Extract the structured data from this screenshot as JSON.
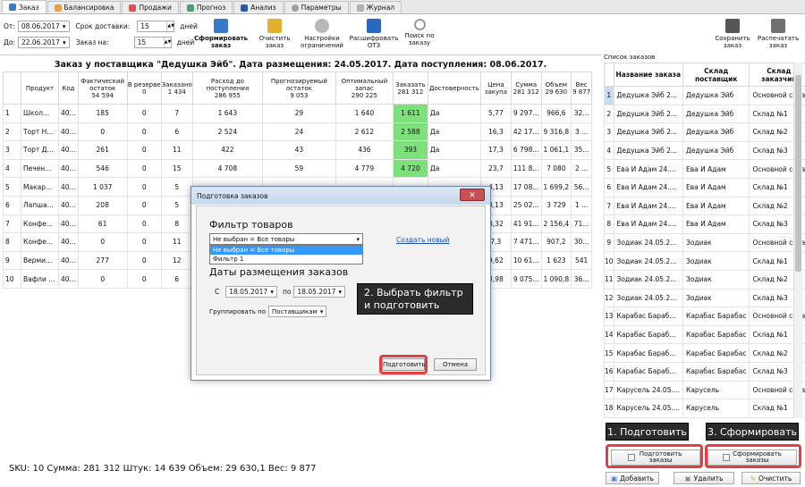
{
  "tabs": [
    {
      "label": "Заказ",
      "color": "#3a78c8"
    },
    {
      "label": "Балансировка",
      "color": "#e8a040"
    },
    {
      "label": "Продажи",
      "color": "#e05050"
    },
    {
      "label": "Прогноз",
      "color": "#4aa06a"
    },
    {
      "label": "Анализ",
      "color": "#2a5aa8"
    },
    {
      "label": "Параметры",
      "color": "#a0a0a0"
    },
    {
      "label": "Журнал",
      "color": "#b0b0b0"
    }
  ],
  "filters": {
    "from_label": "От:",
    "from_value": "08.06.2017",
    "to_label": "До:",
    "to_value": "22.06.2017",
    "delivery_label": "Срок доставки:",
    "delivery_value": "15",
    "days1": "дней",
    "order_for_label": "Заказ на:",
    "order_for_value": "15",
    "days2": "дней"
  },
  "toolbar": {
    "form_order": "Сформировать заказ",
    "clear_order": "Очистить заказ",
    "limit_settings": "Настройки ограничений",
    "decode_ots": "Расшифровать ОТЗ",
    "search_order": "Поиск по заказу",
    "save_order": "Сохранить заказ",
    "print_order": "Распечатать заказ"
  },
  "title": "Заказ у поставщика \"Дедушка Эйб\". Дата размещения: 24.05.2017. Дата поступления: 08.06.2017.",
  "columns": [
    {
      "h": "Продукт",
      "s": ""
    },
    {
      "h": "Код",
      "s": ""
    },
    {
      "h": "Фактический остаток",
      "s": "54 594"
    },
    {
      "h": "В резерве",
      "s": "0"
    },
    {
      "h": "Заказано",
      "s": "1 434"
    },
    {
      "h": "Расход до поступления",
      "s": "286 955"
    },
    {
      "h": "Прогнозируемый остаток",
      "s": "9 053"
    },
    {
      "h": "Оптимальный запас",
      "s": "290 225"
    },
    {
      "h": "Заказать",
      "s": "281 312"
    },
    {
      "h": "Достоверность",
      "s": ""
    },
    {
      "h": "Цена закупа",
      "s": ""
    },
    {
      "h": "Сумма",
      "s": "281 312"
    },
    {
      "h": "Объем",
      "s": "29 630"
    },
    {
      "h": "Вес",
      "s": "9 877"
    }
  ],
  "rows": [
    [
      "1",
      "Школ...",
      "40...",
      "185",
      "0",
      "7",
      "1 643",
      "29",
      "1 640",
      "1 611",
      "Да",
      "5,77",
      "9 297...",
      "966,6",
      "32..."
    ],
    [
      "2",
      "Торт Н...",
      "40...",
      "0",
      "0",
      "6",
      "2 524",
      "24",
      "2 612",
      "2 588",
      "Да",
      "16,3",
      "42 17...",
      "9 316,8",
      "3 ..."
    ],
    [
      "3",
      "Торт Д...",
      "40...",
      "261",
      "0",
      "11",
      "422",
      "43",
      "436",
      "393",
      "Да",
      "17,3",
      "6 798...",
      "1 061,1",
      "35..."
    ],
    [
      "4",
      "Печен...",
      "40...",
      "546",
      "0",
      "15",
      "4 708",
      "59",
      "4 779",
      "4 720",
      "Да",
      "23,7",
      "111 8...",
      "7 080",
      "2 ..."
    ],
    [
      "5",
      "Макар...",
      "40...",
      "1 037",
      "0",
      "5",
      "",
      "",
      "",
      "",
      "",
      "4,13",
      "17 08...",
      "1 699,2",
      "56..."
    ],
    [
      "6",
      "Лапша...",
      "40...",
      "208",
      "0",
      "5",
      "",
      "",
      "",
      "",
      "",
      "8,13",
      "25 02...",
      "3 729",
      "1 ..."
    ],
    [
      "7",
      "Конфе...",
      "40...",
      "61",
      "0",
      "8",
      "",
      "",
      "",
      "",
      "",
      "8,32",
      "41 91...",
      "2 156,4",
      "71..."
    ],
    [
      "8",
      "Конфе...",
      "40...",
      "0",
      "0",
      "11",
      "",
      "",
      "",
      "",
      "",
      "7,3",
      "7 471...",
      "907,2",
      "30..."
    ],
    [
      "9",
      "Верми...",
      "40...",
      "277",
      "0",
      "12",
      "",
      "",
      "",
      "",
      "",
      "9,62",
      "10 61...",
      "1 623",
      "541"
    ],
    [
      "10",
      "Вафли ...",
      "40...",
      "0",
      "0",
      "6",
      "",
      "",
      "",
      "",
      "",
      "8,98",
      "9 075...",
      "1 090,8",
      "36..."
    ]
  ],
  "status": "SKU: 10 Сумма: 281 312 Штук: 14 639 Объем: 29 630,1 Вес: 9 877",
  "right": {
    "caption": "Список заказов",
    "headers": [
      "Название заказа",
      "Склад поставщик",
      "Склад заказчик"
    ],
    "rows": [
      [
        "1",
        "Дедушка Эйб 2...",
        "Дедушка Эйб",
        "Основной скла"
      ],
      [
        "2",
        "Дедушка Эйб 2...",
        "Дедушка Эйб",
        "Склад №1"
      ],
      [
        "3",
        "Дедушка Эйб 2...",
        "Дедушка Эйб",
        "Склад №2"
      ],
      [
        "4",
        "Дедушка Эйб 2...",
        "Дедушка Эйб",
        "Склад №3"
      ],
      [
        "5",
        "Ева И Адам 24....",
        "Ева И Адам",
        "Основной скла"
      ],
      [
        "6",
        "Ева И Адам 24....",
        "Ева И Адам",
        "Склад №1"
      ],
      [
        "7",
        "Ева И Адам 24....",
        "Ева И Адам",
        "Склад №2"
      ],
      [
        "8",
        "Ева И Адам 24....",
        "Ева И Адам",
        "Склад №3"
      ],
      [
        "9",
        "Зодиак 24.05.2...",
        "Зодиак",
        "Основной скла"
      ],
      [
        "10",
        "Зодиак 24.05.2...",
        "Зодиак",
        "Склад №1"
      ],
      [
        "11",
        "Зодиак 24.05.2...",
        "Зодиак",
        "Склад №2"
      ],
      [
        "12",
        "Зодиак 24.05.2...",
        "Зодиак",
        "Склад №3"
      ],
      [
        "13",
        "Карабас Бараб...",
        "Карабас Барабас",
        "Основной скла"
      ],
      [
        "14",
        "Карабас Бараб...",
        "Карабас Барабас",
        "Склад №1"
      ],
      [
        "15",
        "Карабас Бараб...",
        "Карабас Барабас",
        "Склад №2"
      ],
      [
        "16",
        "Карабас Бараб...",
        "Карабас Барабас",
        "Склад №3"
      ],
      [
        "17",
        "Карусель 24.05....",
        "Карусель",
        "Основной скла"
      ],
      [
        "18",
        "Карусель 24.05....",
        "Карусель",
        "Склад №1"
      ]
    ],
    "prepare_orders": "Подготовить заказы",
    "formed_orders": "Сформировать заказы",
    "add": "Добавить",
    "delete": "Удалить",
    "clear": "Очистить"
  },
  "dialog": {
    "title": "Подготовка заказов",
    "filter_heading": "Фильтр товаров",
    "filter_selected": "Не выбран = Все товары",
    "filter_options": [
      "Не выбран = Все товары",
      "Фильтр 1"
    ],
    "create_new": "Создать новый",
    "dates_heading": "Даты размещения заказов",
    "from_label": "С",
    "from_value": "18.05.2017",
    "to_label": "по",
    "to_value": "18.05.2017",
    "group_label": "Группировать по",
    "group_value": "Поставщикам",
    "prepare": "Подготовить",
    "cancel": "Отмена"
  },
  "callouts": {
    "step2": "2. Выбрать фильтр и подготовить",
    "step1": "1. Подготовить",
    "step3": "3. Сформировать"
  },
  "colors": {
    "green_cell": "#7ee07a",
    "callout_bg": "#2b2b2b",
    "highlight_red": "#e04040",
    "selected_row": "#c9dcf2"
  }
}
